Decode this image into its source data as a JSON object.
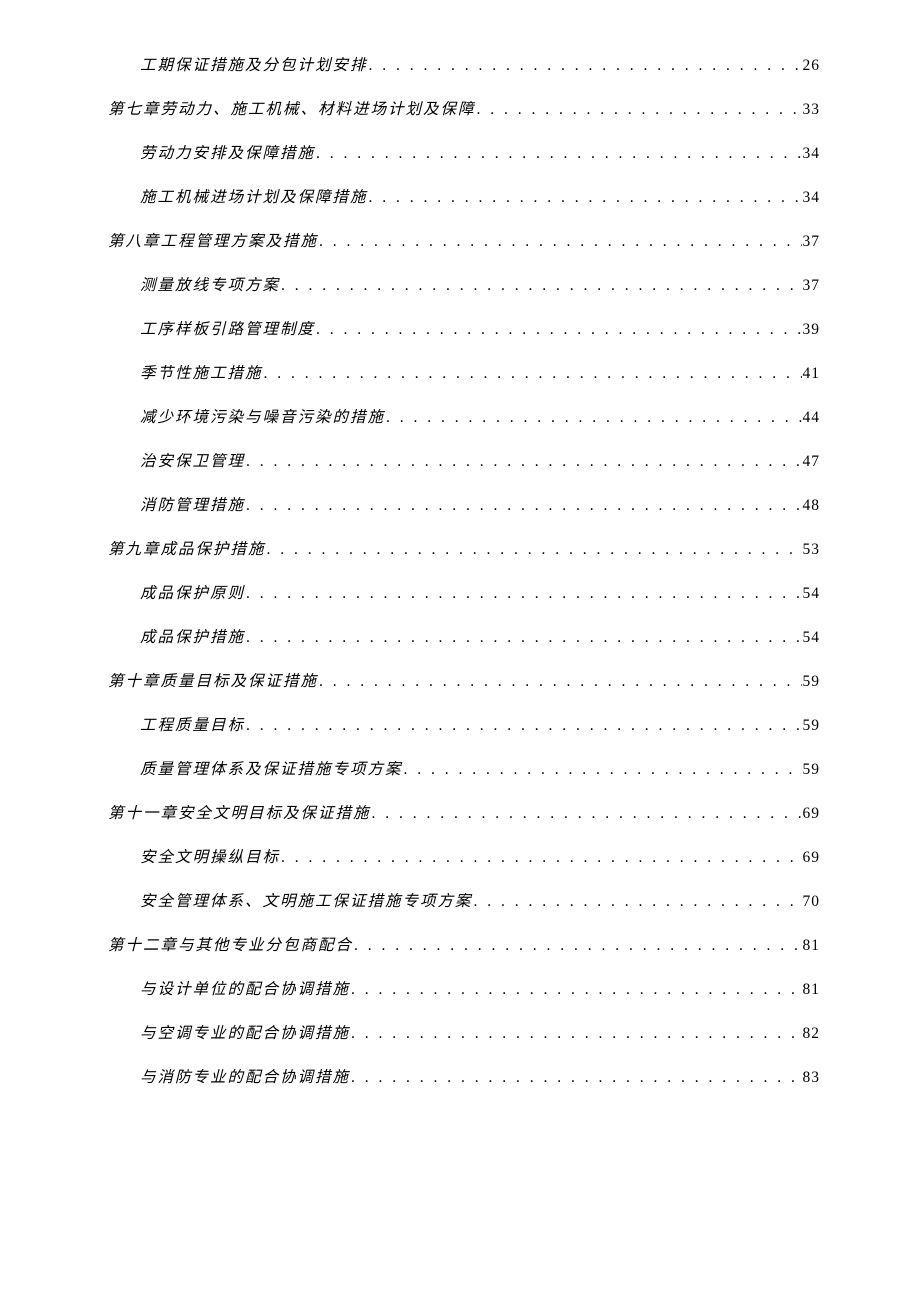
{
  "entries": [
    {
      "level": 2,
      "title": "工期保证措施及分包计划安排",
      "page": "26",
      "gap": false
    },
    {
      "level": 1,
      "title": "第七章劳动力、施工机械、材料进场计划及保障",
      "page": "33",
      "gap": true
    },
    {
      "level": 2,
      "title": "劳动力安排及保障措施",
      "page": "34",
      "gap": false
    },
    {
      "level": 2,
      "title": "施工机械进场计划及保障措施",
      "page": "34",
      "gap": false
    },
    {
      "level": 1,
      "title": "第八章工程管理方案及措施",
      "page": "37",
      "gap": true
    },
    {
      "level": 2,
      "title": "测量放线专项方案",
      "page": "37",
      "gap": false
    },
    {
      "level": 2,
      "title": "工序样板引路管理制度",
      "page": "39",
      "gap": false
    },
    {
      "level": 2,
      "title": "季节性施工措施",
      "page": "41",
      "gap": false
    },
    {
      "level": 2,
      "title": "减少环境污染与噪音污染的措施",
      "page": "44",
      "gap": false
    },
    {
      "level": 2,
      "title": "治安保卫管理",
      "page": "47",
      "gap": false
    },
    {
      "level": 2,
      "title": "消防管理措施",
      "page": "48",
      "gap": false
    },
    {
      "level": 1,
      "title": "第九章成品保护措施",
      "page": "53",
      "gap": true
    },
    {
      "level": 2,
      "title": "成品保护原则",
      "page": "54",
      "gap": false
    },
    {
      "level": 2,
      "title": "成品保护措施",
      "page": "54",
      "gap": false
    },
    {
      "level": 1,
      "title": "第十章质量目标及保证措施",
      "page": "59",
      "gap": true
    },
    {
      "level": 2,
      "title": "工程质量目标",
      "page": "59",
      "gap": false
    },
    {
      "level": 2,
      "title": "质量管理体系及保证措施专项方案",
      "page": "59",
      "gap": false
    },
    {
      "level": 1,
      "title": "第十一章安全文明目标及保证措施",
      "page": "69",
      "gap": true
    },
    {
      "level": 2,
      "title": "安全文明操纵目标",
      "page": "69",
      "gap": false
    },
    {
      "level": 2,
      "title": "安全管理体系、文明施工保证措施专项方案",
      "page": "70",
      "gap": false
    },
    {
      "level": 1,
      "title": "第十二章与其他专业分包商配合",
      "page": "81",
      "gap": true
    },
    {
      "level": 2,
      "title": "与设计单位的配合协调措施",
      "page": "81",
      "gap": false
    },
    {
      "level": 2,
      "title": "与空调专业的配合协调措施",
      "page": "82",
      "gap": false
    },
    {
      "level": 2,
      "title": "与消防专业的配合协调措施",
      "page": "83",
      "gap": false
    }
  ],
  "dots": ". . . . . . . . . . . . . . . . . . . . . . . . . . . . . . . . . . . . . . . . . . . . . . . . . . . . . . . . . . . . . . . . . . . . . . . . . . . . . . . . . . . . . . . . . . . . . . . . . . . . . . . . . . . . . . . . . . . . . . . ."
}
